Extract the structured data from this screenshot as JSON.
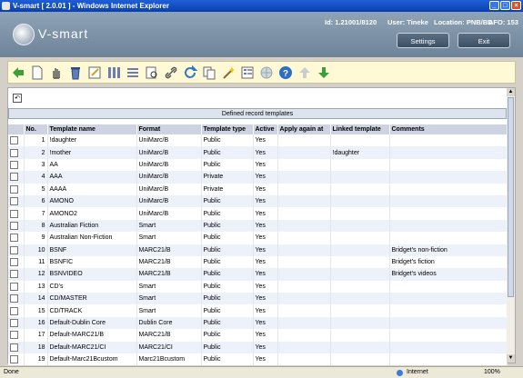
{
  "window": {
    "title": "V-smart [ 2.0.01 ] - Windows Internet Explorer",
    "minimize": "_",
    "maximize": "□",
    "close": "×"
  },
  "header": {
    "logo_text": "V-smart",
    "id_label": "Id: 1.21001/8120",
    "user_label": "User: Tineke",
    "location_label": "Location: PNB/BD",
    "afo_label": "AFO: 153",
    "settings_label": "Settings",
    "exit_label": "Exit"
  },
  "toolbar": {
    "icons": [
      "back-arrow-icon",
      "new-page-icon",
      "hand-select-icon",
      "delete-icon",
      "edit-icon",
      "columns-icon",
      "list-icon",
      "preview-icon",
      "link-icon",
      "refresh-icon",
      "copy-icon",
      "magic-wand-icon",
      "properties-icon",
      "globe-icon",
      "help-icon",
      "up-arrow-icon",
      "down-arrow-icon"
    ]
  },
  "content": {
    "undo": "↶",
    "section_title": "Defined record templates",
    "columns": [
      "No.",
      "Template name",
      "Format",
      "Template type",
      "Active",
      "Apply again at",
      "Linked template",
      "Comments"
    ],
    "rows": [
      {
        "no": "1",
        "name": "!daughter",
        "format": "UniMarc/B",
        "type": "Public",
        "active": "Yes",
        "apply": "",
        "linked": "",
        "comments": ""
      },
      {
        "no": "2",
        "name": "!mother",
        "format": "UniMarc/B",
        "type": "Public",
        "active": "Yes",
        "apply": "",
        "linked": "!daughter",
        "comments": ""
      },
      {
        "no": "3",
        "name": "AA",
        "format": "UniMarc/B",
        "type": "Public",
        "active": "Yes",
        "apply": "",
        "linked": "",
        "comments": ""
      },
      {
        "no": "4",
        "name": "AAA",
        "format": "UniMarc/B",
        "type": "Private",
        "active": "Yes",
        "apply": "",
        "linked": "",
        "comments": ""
      },
      {
        "no": "5",
        "name": "AAAA",
        "format": "UniMarc/B",
        "type": "Private",
        "active": "Yes",
        "apply": "",
        "linked": "",
        "comments": ""
      },
      {
        "no": "6",
        "name": "AMONO",
        "format": "UniMarc/B",
        "type": "Public",
        "active": "Yes",
        "apply": "",
        "linked": "",
        "comments": ""
      },
      {
        "no": "7",
        "name": "AMONO2",
        "format": "UniMarc/B",
        "type": "Public",
        "active": "Yes",
        "apply": "",
        "linked": "",
        "comments": ""
      },
      {
        "no": "8",
        "name": "Australian Fiction",
        "format": "Smart",
        "type": "Public",
        "active": "Yes",
        "apply": "",
        "linked": "",
        "comments": ""
      },
      {
        "no": "9",
        "name": "Australian Non-Fiction",
        "format": "Smart",
        "type": "Public",
        "active": "Yes",
        "apply": "",
        "linked": "",
        "comments": ""
      },
      {
        "no": "10",
        "name": "BSNF",
        "format": "MARC21/B",
        "type": "Public",
        "active": "Yes",
        "apply": "",
        "linked": "",
        "comments": "Bridget's non-fiction"
      },
      {
        "no": "11",
        "name": "BSNFIC",
        "format": "MARC21/B",
        "type": "Public",
        "active": "Yes",
        "apply": "",
        "linked": "",
        "comments": "Bridget's fiction"
      },
      {
        "no": "12",
        "name": "BSNVIDEO",
        "format": "MARC21/B",
        "type": "Public",
        "active": "Yes",
        "apply": "",
        "linked": "",
        "comments": "Bridget's videos"
      },
      {
        "no": "13",
        "name": "CD's",
        "format": "Smart",
        "type": "Public",
        "active": "Yes",
        "apply": "",
        "linked": "",
        "comments": ""
      },
      {
        "no": "14",
        "name": "CD/MASTER",
        "format": "Smart",
        "type": "Public",
        "active": "Yes",
        "apply": "",
        "linked": "",
        "comments": ""
      },
      {
        "no": "15",
        "name": "CD/TRACK",
        "format": "Smart",
        "type": "Public",
        "active": "Yes",
        "apply": "",
        "linked": "",
        "comments": ""
      },
      {
        "no": "16",
        "name": "Default-Dublin Core",
        "format": "Dublin Core",
        "type": "Public",
        "active": "Yes",
        "apply": "",
        "linked": "",
        "comments": ""
      },
      {
        "no": "17",
        "name": "Default-MARC21/B",
        "format": "MARC21/B",
        "type": "Public",
        "active": "Yes",
        "apply": "",
        "linked": "",
        "comments": ""
      },
      {
        "no": "18",
        "name": "Default-MARC21/CI",
        "format": "MARC21/CI",
        "type": "Public",
        "active": "Yes",
        "apply": "",
        "linked": "",
        "comments": ""
      },
      {
        "no": "19",
        "name": "Default-Marc21Bcustom",
        "format": "Marc21Bcustom",
        "type": "Public",
        "active": "Yes",
        "apply": "",
        "linked": "",
        "comments": ""
      }
    ]
  },
  "statusbar": {
    "left": "Done",
    "zone": "Internet",
    "zoom": "100%"
  },
  "colors": {
    "titlebar": "#0a3fb0",
    "header": "#7a8fa3",
    "toolbar": "#fff9d6",
    "row_alt": "#edf1fa",
    "table_header": "#cdd3e0"
  }
}
